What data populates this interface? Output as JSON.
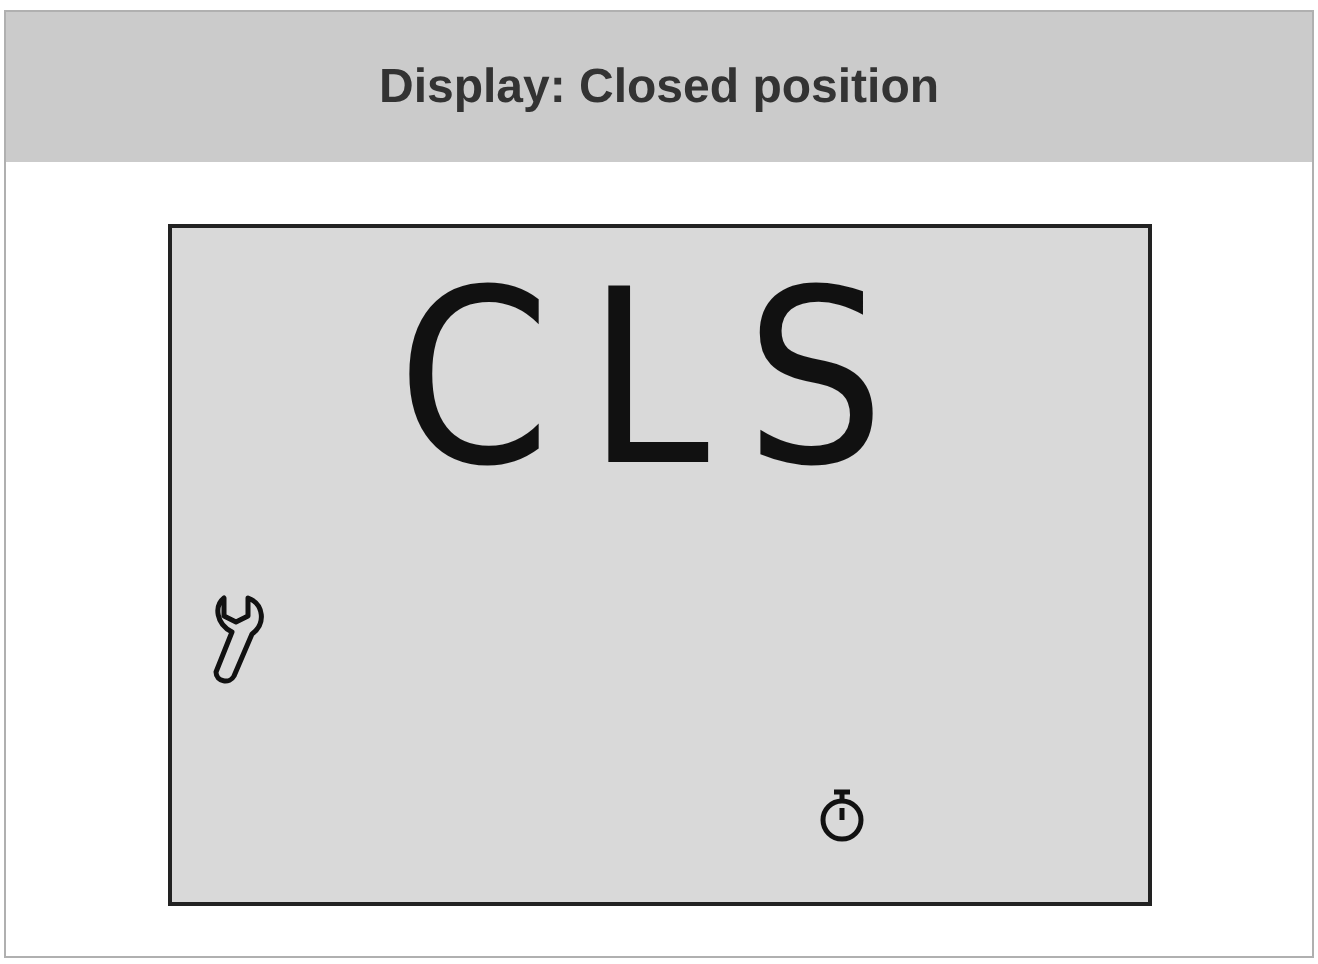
{
  "header": {
    "title": "Display: Closed position"
  },
  "display": {
    "reading": "CLS"
  }
}
